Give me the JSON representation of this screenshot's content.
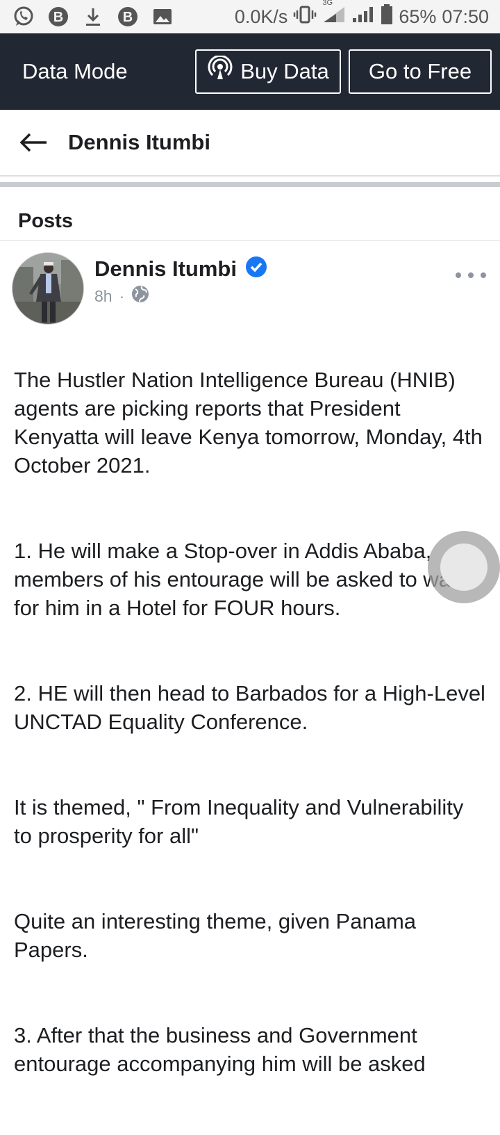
{
  "status_bar": {
    "network_speed": "0.0K/s",
    "network_type": "3G",
    "battery": "65%",
    "time": "07:50",
    "left_icons": [
      "whatsapp-icon",
      "b-app-icon",
      "download-icon",
      "b-app-icon",
      "image-icon"
    ]
  },
  "data_mode": {
    "title": "Data Mode",
    "buy_label": "Buy Data",
    "free_label": "Go to Free"
  },
  "header": {
    "title": "Dennis Itumbi"
  },
  "section": {
    "posts_label": "Posts"
  },
  "post": {
    "author": "Dennis Itumbi",
    "verified": true,
    "time": "8h",
    "audience": "public",
    "paragraphs": [
      "The Hustler Nation Intelligence Bureau (HNIB) agents are picking reports that President Kenyatta will leave Kenya tomorrow, Monday, 4th October 2021.",
      "1. He will make a Stop-over in Addis Ababa, members of his entourage will be asked to wait for him in a Hotel for FOUR hours.",
      "2. HE will then head to Barbados for a High-Level UNCTAD Equality Conference.",
      "It is themed, \" From Inequality and Vulnerability to prosperity for all\"",
      "Quite an interesting theme, given Panama Papers.",
      "3. After that the business and Government entourage accompanying him will be asked"
    ]
  },
  "colors": {
    "status_bar_bg": "#f4f4f4",
    "data_mode_bg": "#222833",
    "verified_blue": "#1877f2",
    "meta_gray": "#8d949e"
  }
}
